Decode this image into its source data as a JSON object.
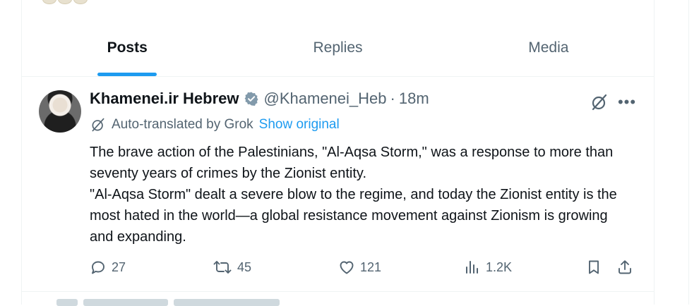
{
  "tabs": [
    {
      "label": "Posts",
      "active": true
    },
    {
      "label": "Replies",
      "active": false
    },
    {
      "label": "Media",
      "active": false
    }
  ],
  "post": {
    "display_name": "Khamenei.ir Hebrew",
    "handle": "@Khamenei_Heb",
    "separator": "·",
    "time": "18m",
    "translation_note": "Auto-translated by Grok",
    "show_original": "Show original",
    "text_lines": [
      "The brave action of the Palestinians, \"Al-Aqsa Storm,\" was a response to more than seventy years of crimes by the Zionist entity.",
      "\"Al-Aqsa Storm\" dealt a severe blow to the regime, and today the Zionist entity is the most hated in the world—a global resistance movement against Zionism is growing and expanding."
    ],
    "replies": "27",
    "reposts": "45",
    "likes": "121",
    "views": "1.2K"
  },
  "colors": {
    "accent": "#1d9bf0",
    "muted": "#536471",
    "text": "#0f1419",
    "border": "#eff3f4"
  },
  "icons": {
    "verified": "verified-badge-icon",
    "grok": "grok-icon",
    "more": "more-icon",
    "reply": "reply-icon",
    "repost": "repost-icon",
    "like": "heart-icon",
    "views": "views-icon",
    "bookmark": "bookmark-icon",
    "share": "share-icon"
  }
}
